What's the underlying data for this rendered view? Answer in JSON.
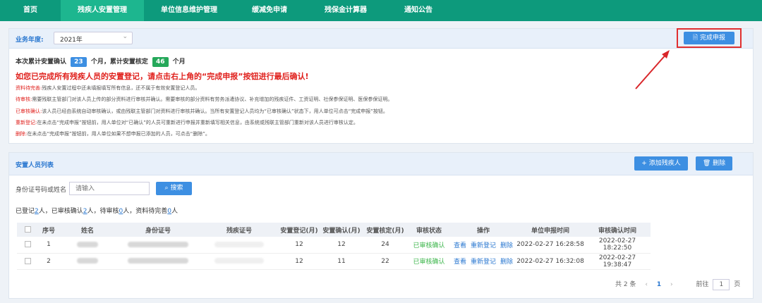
{
  "nav": {
    "items": [
      {
        "label": "首页"
      },
      {
        "label": "残疾人安置管理"
      },
      {
        "label": "单位信息维护管理"
      },
      {
        "label": "缓减免申请"
      },
      {
        "label": "残保金计算器"
      },
      {
        "label": "通知公告"
      }
    ]
  },
  "year_panel": {
    "year_label": "业务年度:",
    "year_value": "2021年",
    "complete_button": "完成申报",
    "summary_prefix": "本次累计安置确认",
    "confirm_months": "23",
    "summary_mid": "个月，累计安置核定",
    "approved_months": "46",
    "summary_suffix": "个月",
    "warning": "如您已完成所有残疾人员的安置登记，请点击右上角的“完成申报”按钮进行最后确认!",
    "notes": [
      {
        "key": "资料待完善:",
        "text": "残疾人安置过程中还未填报填写所有信息，还不属于有效安置登记人员。"
      },
      {
        "key": "待审核:",
        "text": "需要残联主管部门对该人员上传的部分资料进行审核并确认。需要审核的部分资料有劳务派遣协议、补充增加的残疾证件、工资证明、社保参保证明、医保参保证明。"
      },
      {
        "key": "已审核确认:",
        "text": "该人员已经由系统自动审核确认，或由残联主管部门对资料进行审核并确认。当所有安置登记人员均为“已审核确认”状态下，用人单位可点击“完成申报”按钮。"
      },
      {
        "key": "重新登记:",
        "text": "在未点击“完成申报”按钮前，用人单位对“已确认”的人员可重新进行申报并重新填写相关信息，由系统或残联主管部门重新对该人员进行审核认定。"
      },
      {
        "key": "删除:",
        "text": "在未点击“完成申报”按钮前，用人单位如果不想申报已添加的人员，可点击“删除”。"
      }
    ]
  },
  "list_panel": {
    "title": "安置人员列表",
    "add_button": "+ 添加残疾人",
    "delete_button": "删除",
    "search_label": "身份证号码或姓名",
    "search_placeholder": "请输入",
    "search_button": "搜索",
    "stats": {
      "p1": "已登记",
      "v1": "2",
      "p2": "人，已审核确认",
      "v2": "2",
      "p3": "人，待审核",
      "v3": "0",
      "p4": "人，资料待完善",
      "v4": "0",
      "p5": "人"
    },
    "columns": [
      "序号",
      "姓名",
      "身份证号",
      "残疾证号",
      "安置登记(月)",
      "安置确认(月)",
      "安置核定(月)",
      "审核状态",
      "操作",
      "单位申报时间",
      "审核确认时间"
    ],
    "rows": [
      {
        "no": "1",
        "reg": "12",
        "confirm": "12",
        "approved": "24",
        "status": "已审核确认",
        "op1": "查看",
        "op2": "重新登记",
        "op3": "删除",
        "apply_time": "2022-02-27 16:28:58",
        "review_time": "2022-02-27 18:22:50"
      },
      {
        "no": "2",
        "reg": "12",
        "confirm": "11",
        "approved": "22",
        "status": "已审核确认",
        "op1": "查看",
        "op2": "重新登记",
        "op3": "删除",
        "apply_time": "2022-02-27 16:32:08",
        "review_time": "2022-02-27 19:38:47"
      }
    ],
    "pagination": {
      "total": "共 2 条",
      "prev": "‹",
      "page": "1",
      "next": "›",
      "goto_label": "前往",
      "goto_value": "1",
      "goto_suffix": "页"
    }
  },
  "colors": {
    "nav_bg": "#0d9a7c",
    "nav_active": "#1db68f",
    "accent_blue": "#3d8fe2",
    "warning_red": "#e0201c",
    "status_green": "#3bb54a",
    "annotation_red": "#d9262a"
  }
}
